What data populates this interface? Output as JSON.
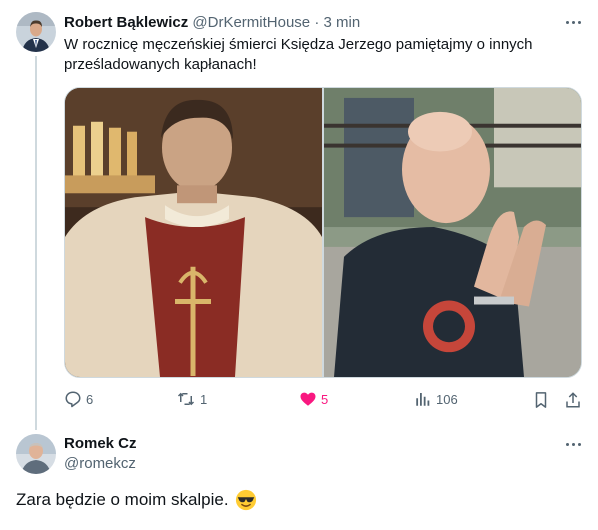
{
  "tweet": {
    "author_name": "Robert Bąklewicz",
    "author_handle": "@DrKermitHouse",
    "separator": "·",
    "time": "3 min",
    "text": "W rocznicę męczeńskiej śmierci Księdza Jerzego pamiętajmy o innych prześladowanych kapłanach!",
    "images": [
      {
        "icon": "historical-priest-photo"
      },
      {
        "icon": "bald-man-photo"
      }
    ],
    "actions": {
      "reply_count": "6",
      "retweet_count": "1",
      "like_count": "5",
      "views_count": "106"
    },
    "like_color": "#f91880"
  },
  "reply": {
    "author_name": "Romek Cz",
    "author_handle": "@romekcz",
    "text": "Zara będzie o moim skalpie.",
    "emoji": "smiling-face-with-sunglasses"
  },
  "colors": {
    "text": "#0f1419",
    "muted": "#536471",
    "border": "#cfd9de"
  }
}
